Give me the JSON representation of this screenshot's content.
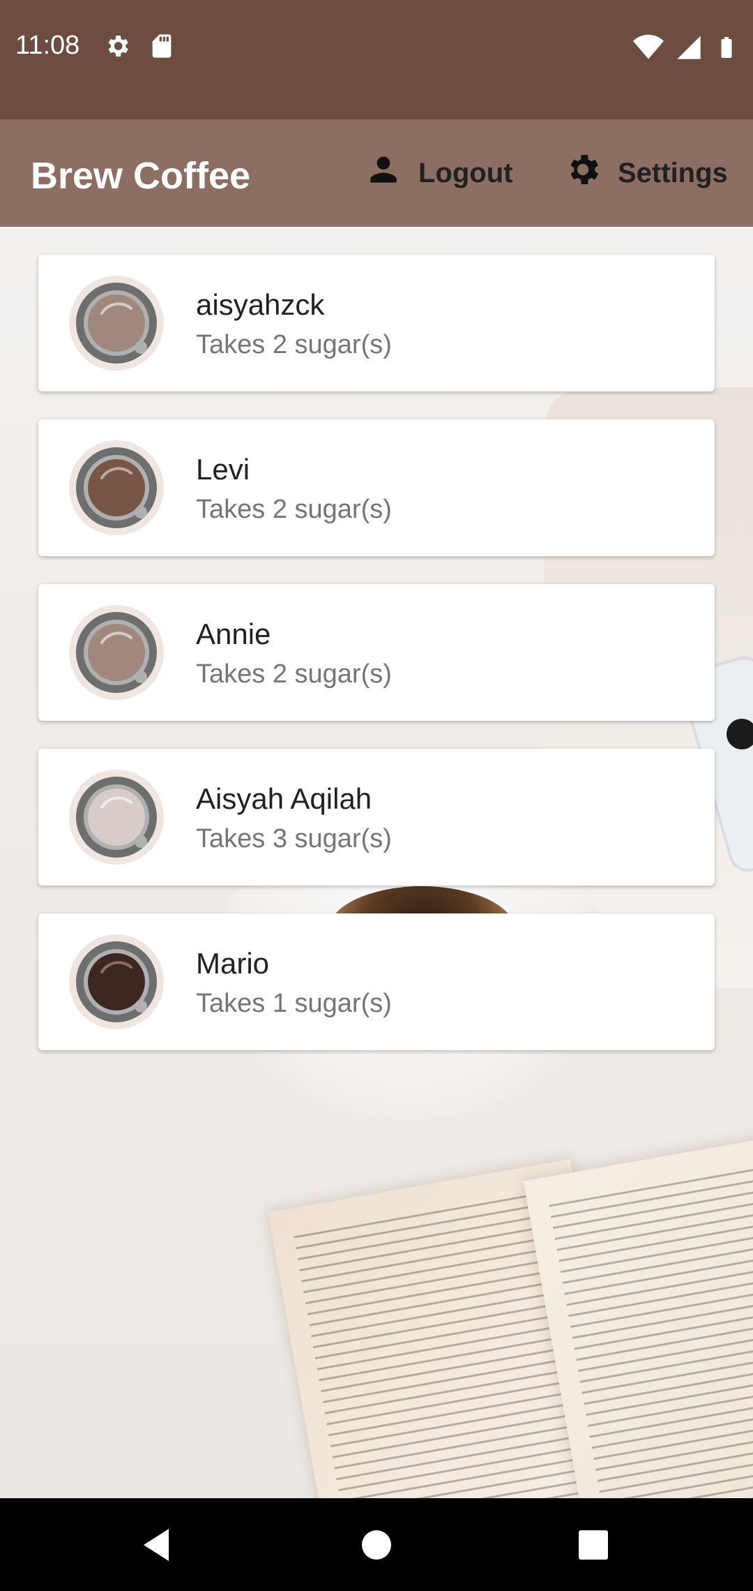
{
  "status_bar": {
    "time": "11:08"
  },
  "app_bar": {
    "title": "Brew Coffee",
    "logout_label": "Logout",
    "settings_label": "Settings"
  },
  "people": [
    {
      "name": "aisyahzck",
      "subtitle": "Takes 2 sugar(s)",
      "coffee_color": "#a1887f"
    },
    {
      "name": "Levi",
      "subtitle": "Takes 2 sugar(s)",
      "coffee_color": "#795548"
    },
    {
      "name": "Annie",
      "subtitle": "Takes 2 sugar(s)",
      "coffee_color": "#a1887f"
    },
    {
      "name": "Aisyah Aqilah",
      "subtitle": "Takes 3 sugar(s)",
      "coffee_color": "#d7ccc8"
    },
    {
      "name": "Mario",
      "subtitle": "Takes 1 sugar(s)",
      "coffee_color": "#3e2723"
    }
  ],
  "colors": {
    "status_bar": "#6d4c41",
    "app_bar": "#8d6e63"
  },
  "icons": {
    "status": [
      "gear-icon",
      "sd-card-icon",
      "wifi-icon",
      "signal-icon",
      "battery-icon"
    ],
    "app_bar": [
      "person-icon",
      "gear-icon"
    ],
    "nav": [
      "back-icon",
      "home-icon",
      "recents-icon"
    ]
  }
}
